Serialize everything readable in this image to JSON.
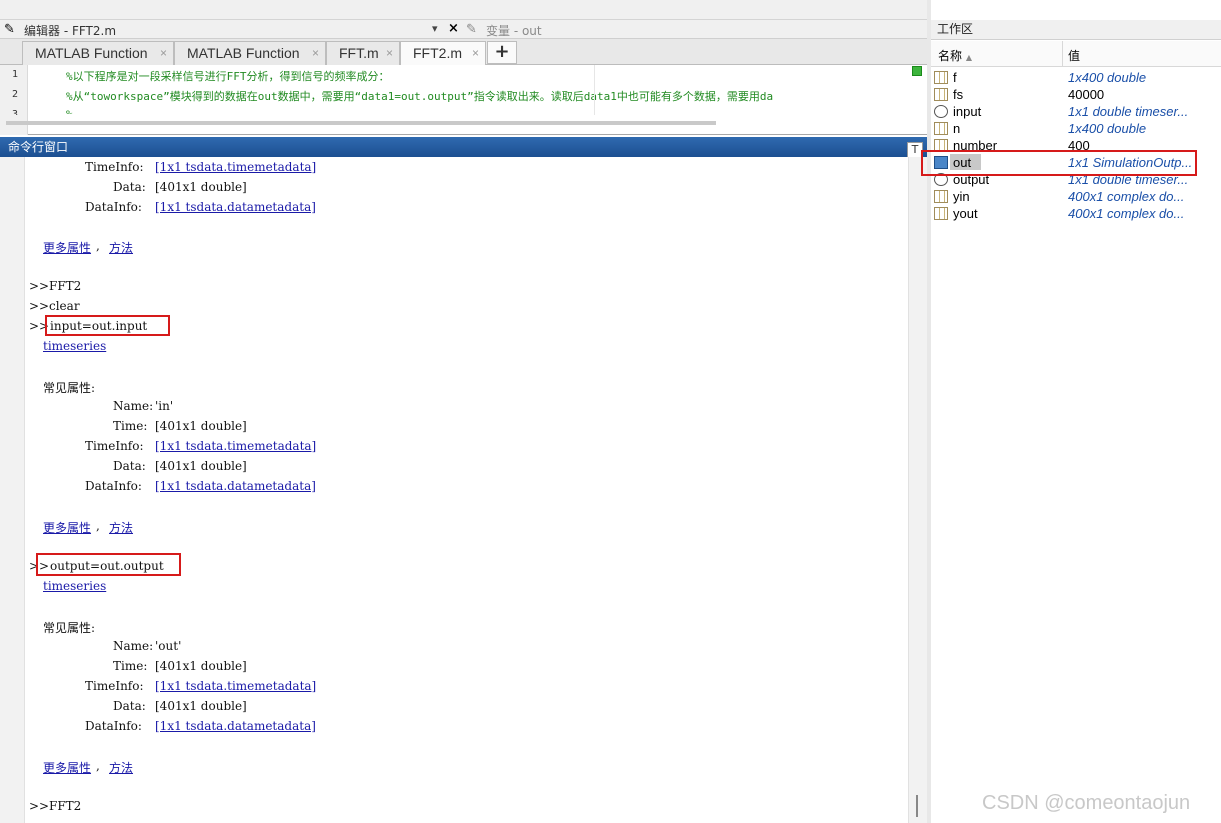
{
  "editor": {
    "title": "编辑器 - FFT2.m",
    "dropdown_icon": "▾",
    "close_icon": "×",
    "variables_title": "变量 - out",
    "tabs": [
      {
        "label": "MATLAB Function",
        "close": "×"
      },
      {
        "label": "MATLAB Function",
        "close": "×"
      },
      {
        "label": "FFT.m",
        "close": "×"
      },
      {
        "label": "FFT2.m",
        "close": "×"
      }
    ],
    "add_tab": "+",
    "lines": [
      {
        "num": "1",
        "text": "%以下程序是对一段采样信号进行FFT分析，得到信号的频率成分："
      },
      {
        "num": "2",
        "text": "%从“toworkspace”模块得到的数据在out数据中，需要用“data1=out.output”指令读取出来。读取后data1中也可能有多个数据，需要用da"
      },
      {
        "num": "3",
        "text": "%"
      }
    ]
  },
  "command_window": {
    "title": "命令行窗口",
    "toolbar_glyph": "T",
    "block1": {
      "timeinfo_label": "TimeInfo:",
      "timeinfo_link": "[1x1 tsdata.timemetadata]",
      "data_label": "Data:",
      "data_value": "[401x1 double]",
      "datainfo_label": "DataInfo:",
      "datainfo_link": "[1x1 tsdata.datametadata]",
      "more": "更多属性",
      "comma": ",",
      "methods": "方法"
    },
    "prompt": ">>",
    "cmd_fft2": "FFT2",
    "cmd_clear": "clear",
    "cmd_input": "input=out.input",
    "block2": {
      "type_link": "timeseries",
      "common_props": "常见属性:",
      "name_label": "Name:",
      "name_value": "'in'",
      "time_label": "Time:",
      "time_value": "[401x1 double]",
      "timeinfo_label": "TimeInfo:",
      "timeinfo_link": "[1x1 tsdata.timemetadata]",
      "data_label": "Data:",
      "data_value": "[401x1 double]",
      "datainfo_label": "DataInfo:",
      "datainfo_link": "[1x1 tsdata.datametadata]",
      "more": "更多属性",
      "comma": ",",
      "methods": "方法"
    },
    "cmd_output": "output=out.output",
    "block3": {
      "type_link": "timeseries",
      "common_props": "常见属性:",
      "name_label": "Name:",
      "name_value": "'out'",
      "time_label": "Time:",
      "time_value": "[401x1 double]",
      "timeinfo_label": "TimeInfo:",
      "timeinfo_link": "[1x1 tsdata.timemetadata]",
      "data_label": "Data:",
      "data_value": "[401x1 double]",
      "datainfo_label": "DataInfo:",
      "datainfo_link": "[1x1 tsdata.datametadata]",
      "more": "更多属性",
      "comma": ",",
      "methods": "方法"
    },
    "cmd_fft2_last": "FFT2"
  },
  "workspace": {
    "title": "工作区",
    "col_name": "名称",
    "sort_icon": "▲",
    "col_value": "值",
    "variables": [
      {
        "name": "f",
        "value": "1x400 double",
        "italic": true,
        "icon": "matrix-icon"
      },
      {
        "name": "fs",
        "value": "40000",
        "italic": false,
        "icon": "matrix-icon"
      },
      {
        "name": "input",
        "value": "1x1 double timeser...",
        "italic": true,
        "icon": "timeseries-icon"
      },
      {
        "name": "n",
        "value": "1x400 double",
        "italic": true,
        "icon": "matrix-icon"
      },
      {
        "name": "number",
        "value": "400",
        "italic": false,
        "icon": "matrix-icon"
      },
      {
        "name": "out",
        "value": "1x1 SimulationOutp...",
        "italic": true,
        "icon": "object-icon"
      },
      {
        "name": "output",
        "value": "1x1 double timeser...",
        "italic": true,
        "icon": "timeseries-icon"
      },
      {
        "name": "yin",
        "value": "400x1 complex do...",
        "italic": true,
        "icon": "matrix-icon"
      },
      {
        "name": "yout",
        "value": "400x1 complex do...",
        "italic": true,
        "icon": "matrix-icon"
      }
    ]
  },
  "watermark": "CSDN @comeontaojun",
  "colors": {
    "cmd_title_bg": "#1c4f91",
    "comment_green": "#228b22",
    "link_blue": "#1a1aa8",
    "highlight_red": "#d61a1a",
    "ws_value_blue": "#1a4fa8"
  }
}
